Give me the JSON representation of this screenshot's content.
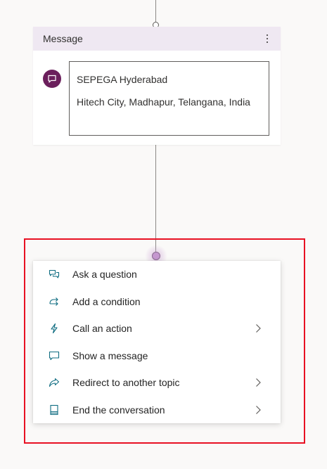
{
  "message_card": {
    "header_title": "Message",
    "message_lines": [
      "SEPEGA Hyderabad",
      "Hitech City, Madhapur, Telangana, India"
    ],
    "avatar_color": "#6b1f5c",
    "header_color": "#efe8f2"
  },
  "menu": {
    "items": [
      {
        "label": "Ask a question",
        "icon": "question-chat-icon",
        "has_submenu": false
      },
      {
        "label": "Add a condition",
        "icon": "branch-icon",
        "has_submenu": false
      },
      {
        "label": "Call an action",
        "icon": "lightning-icon",
        "has_submenu": true
      },
      {
        "label": "Show a message",
        "icon": "message-icon",
        "has_submenu": false
      },
      {
        "label": "Redirect to another topic",
        "icon": "share-arrow-icon",
        "has_submenu": true
      },
      {
        "label": "End the conversation",
        "icon": "end-icon",
        "has_submenu": true
      }
    ]
  },
  "colors": {
    "accent": "#c597cf",
    "highlight_border": "#e81123",
    "icon_teal": "#0f6c81"
  }
}
